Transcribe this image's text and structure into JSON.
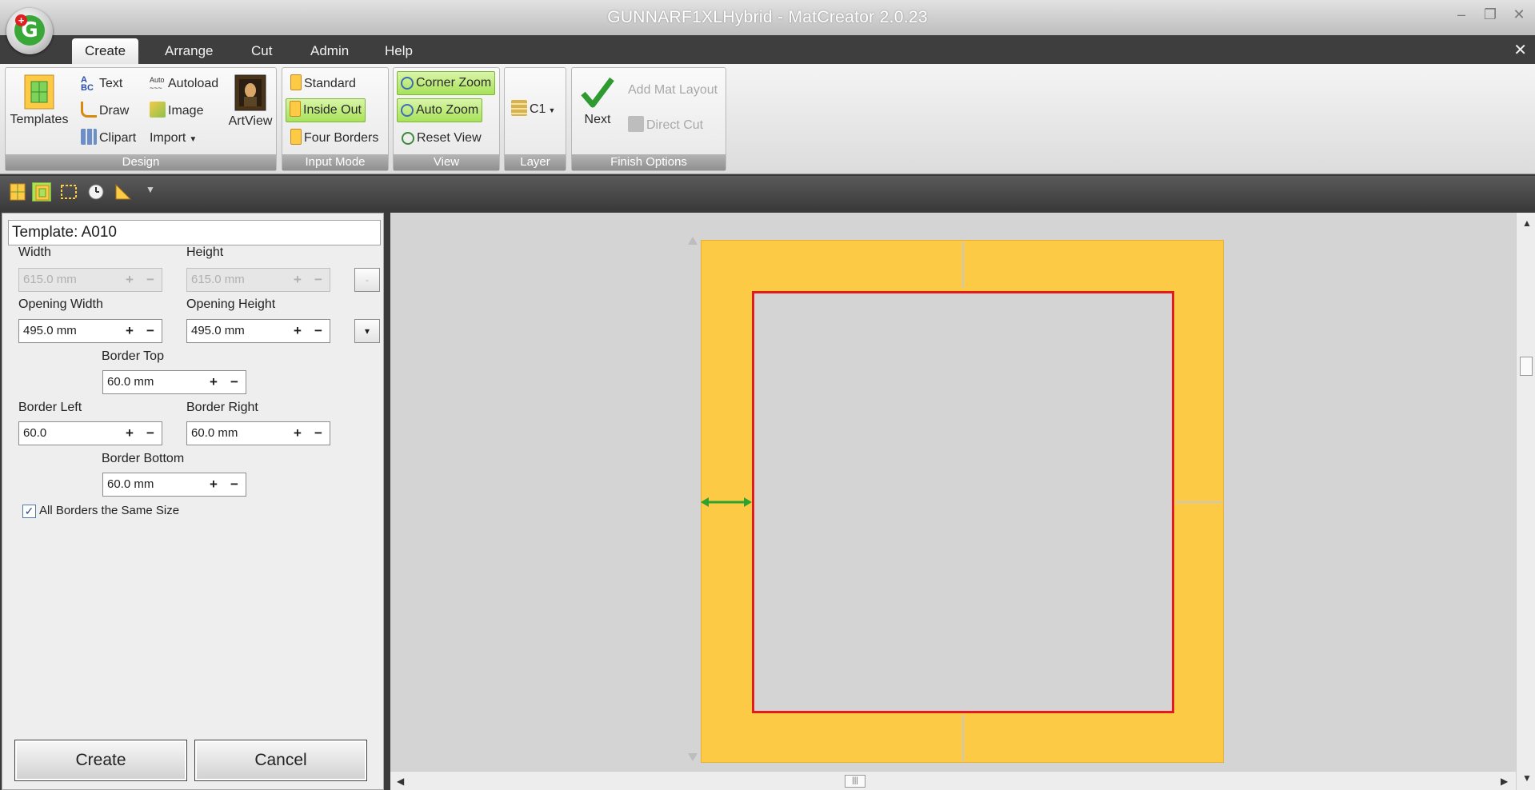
{
  "window": {
    "title": "GUNNARF1XLHybrid - MatCreator 2.0.23",
    "minimize_glyph": "–",
    "restore_glyph": "❐",
    "close_glyph": "✕"
  },
  "menu": {
    "tabs": [
      {
        "label": "Create",
        "active": true
      },
      {
        "label": "Arrange"
      },
      {
        "label": "Cut"
      },
      {
        "label": "Admin"
      },
      {
        "label": "Help"
      }
    ],
    "close_glyph": "✕"
  },
  "ribbon": {
    "design": {
      "label": "Design",
      "templates": "Templates",
      "text": "Text",
      "draw": "Draw",
      "clipart": "Clipart",
      "autoload": "Autoload",
      "image": "Image",
      "import": "Import",
      "artview": "ArtView"
    },
    "input_mode": {
      "label": "Input Mode",
      "standard": "Standard",
      "inside_out": "Inside Out",
      "four_borders": "Four Borders"
    },
    "view": {
      "label": "View",
      "corner_zoom": "Corner Zoom",
      "auto_zoom": "Auto Zoom",
      "reset_view": "Reset View"
    },
    "layer": {
      "label": "Layer",
      "current": "C1"
    },
    "finish": {
      "label": "Finish Options",
      "next": "Next",
      "add_mat_layout": "Add Mat Layout",
      "direct_cut": "Direct Cut"
    }
  },
  "panel": {
    "template_title": "Template: A010",
    "width": {
      "label": "Width",
      "value": "615.0 mm"
    },
    "height": {
      "label": "Height",
      "value": "615.0 mm"
    },
    "opening_width": {
      "label": "Opening Width",
      "value": "495.0 mm"
    },
    "opening_height": {
      "label": "Opening Height",
      "value": "495.0 mm"
    },
    "border_top": {
      "label": "Border Top",
      "value": "60.0 mm"
    },
    "border_left": {
      "label": "Border Left",
      "value": "60.0"
    },
    "border_right": {
      "label": "Border Right",
      "value": "60.0 mm"
    },
    "border_bottom": {
      "label": "Border Bottom",
      "value": "60.0 mm"
    },
    "same_size": {
      "label": "All Borders the Same Size",
      "checked": true
    },
    "plus": "+",
    "minus": "−",
    "lock_glyph": "-",
    "dropdown_glyph": "▾",
    "check_glyph": "✓",
    "create": "Create",
    "cancel": "Cancel"
  },
  "scroll": {
    "up": "▲",
    "down": "▼",
    "left": "◀",
    "right": "▶",
    "grip": "|||"
  },
  "colors": {
    "mat": "#fdca46",
    "opening_border": "#e31b1b",
    "highlight": "#a8e25a",
    "border_arrow": "#2fa12f"
  }
}
